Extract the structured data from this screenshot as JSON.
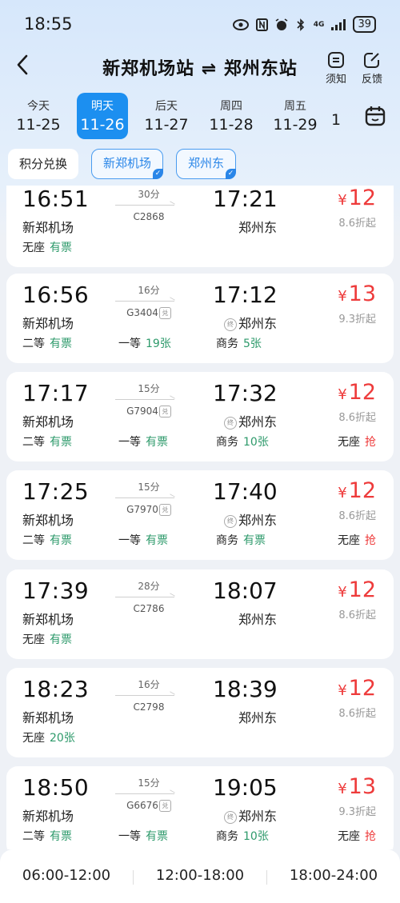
{
  "status_bar": {
    "time": "18:55",
    "signal": "4G",
    "battery": "39"
  },
  "header": {
    "title": "新郑机场站 ⇌ 郑州东站",
    "notice_label": "须知",
    "feedback_label": "反馈"
  },
  "dates": [
    {
      "day": "今天",
      "date": "11-25",
      "selected": false
    },
    {
      "day": "明天",
      "date": "11-26",
      "selected": true
    },
    {
      "day": "后天",
      "date": "11-27",
      "selected": false
    },
    {
      "day": "周四",
      "date": "11-28",
      "selected": false
    },
    {
      "day": "周五",
      "date": "11-29",
      "selected": false
    },
    {
      "day": "",
      "date": "1",
      "selected": false
    }
  ],
  "filters": {
    "points": "积分兑换",
    "from_station": "新郑机场",
    "to_station": "郑州东"
  },
  "trains": [
    {
      "dep": "16:51",
      "from": "新郑机场",
      "dur": "30分",
      "no": "C2868",
      "dui": false,
      "arr": "17:21",
      "to": "郑州东",
      "term": false,
      "price": "12",
      "disc": "8.6折起",
      "seats": [
        {
          "cls": "无座",
          "st": "有票",
          "grab": false
        }
      ]
    },
    {
      "dep": "16:56",
      "from": "新郑机场",
      "dur": "16分",
      "no": "G3404",
      "dui": true,
      "arr": "17:12",
      "to": "郑州东",
      "term": true,
      "price": "13",
      "disc": "9.3折起",
      "seats": [
        {
          "cls": "二等",
          "st": "有票",
          "grab": false
        },
        {
          "cls": "一等",
          "st": "19张",
          "grab": false
        },
        {
          "cls": "商务",
          "st": "5张",
          "grab": false
        }
      ]
    },
    {
      "dep": "17:17",
      "from": "新郑机场",
      "dur": "15分",
      "no": "G7904",
      "dui": true,
      "arr": "17:32",
      "to": "郑州东",
      "term": true,
      "price": "12",
      "disc": "8.6折起",
      "seats": [
        {
          "cls": "二等",
          "st": "有票",
          "grab": false
        },
        {
          "cls": "一等",
          "st": "有票",
          "grab": false
        },
        {
          "cls": "商务",
          "st": "10张",
          "grab": false
        },
        {
          "cls": "无座",
          "st": "抢",
          "grab": true
        }
      ]
    },
    {
      "dep": "17:25",
      "from": "新郑机场",
      "dur": "15分",
      "no": "G7970",
      "dui": true,
      "arr": "17:40",
      "to": "郑州东",
      "term": true,
      "price": "12",
      "disc": "8.6折起",
      "seats": [
        {
          "cls": "二等",
          "st": "有票",
          "grab": false
        },
        {
          "cls": "一等",
          "st": "有票",
          "grab": false
        },
        {
          "cls": "商务",
          "st": "有票",
          "grab": false
        },
        {
          "cls": "无座",
          "st": "抢",
          "grab": true
        }
      ]
    },
    {
      "dep": "17:39",
      "from": "新郑机场",
      "dur": "28分",
      "no": "C2786",
      "dui": false,
      "arr": "18:07",
      "to": "郑州东",
      "term": false,
      "price": "12",
      "disc": "8.6折起",
      "seats": [
        {
          "cls": "无座",
          "st": "有票",
          "grab": false
        }
      ]
    },
    {
      "dep": "18:23",
      "from": "新郑机场",
      "dur": "16分",
      "no": "C2798",
      "dui": false,
      "arr": "18:39",
      "to": "郑州东",
      "term": false,
      "price": "12",
      "disc": "8.6折起",
      "seats": [
        {
          "cls": "无座",
          "st": "20张",
          "grab": false
        }
      ]
    },
    {
      "dep": "18:50",
      "from": "新郑机场",
      "dur": "15分",
      "no": "G6676",
      "dui": true,
      "arr": "19:05",
      "to": "郑州东",
      "term": true,
      "price": "13",
      "disc": "9.3折起",
      "seats": [
        {
          "cls": "二等",
          "st": "有票",
          "grab": false
        },
        {
          "cls": "一等",
          "st": "有票",
          "grab": false
        },
        {
          "cls": "商务",
          "st": "10张",
          "grab": false
        },
        {
          "cls": "无座",
          "st": "抢",
          "grab": true
        }
      ]
    }
  ],
  "labels": {
    "term": "终",
    "dui": "兑",
    "yen": "¥"
  },
  "time_slots": [
    "06:00-12:00",
    "12:00-18:00",
    "18:00-24:00"
  ]
}
